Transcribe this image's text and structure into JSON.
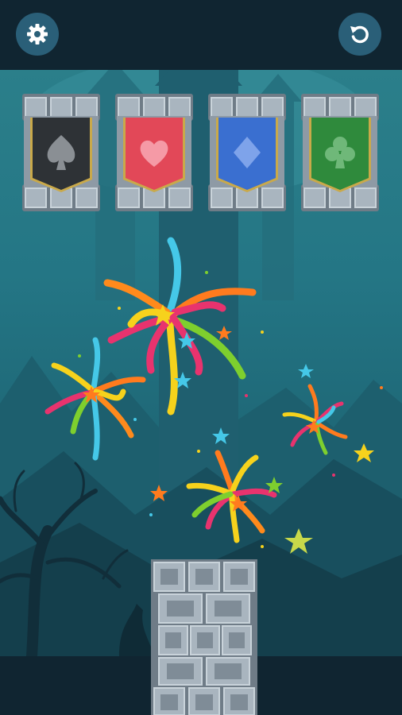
{
  "toolbar": {
    "settings_icon": "gear-icon",
    "restart_icon": "restart-icon"
  },
  "foundations": [
    {
      "suit": "spades",
      "icon": "spade-icon",
      "color": "#2e3236"
    },
    {
      "suit": "hearts",
      "icon": "heart-icon",
      "color": "#e24858"
    },
    {
      "suit": "diamonds",
      "icon": "diamond-icon",
      "color": "#3a6fd0"
    },
    {
      "suit": "clubs",
      "icon": "club-icon",
      "color": "#2f8a3c"
    }
  ],
  "colors": {
    "bar": "#102531",
    "button": "#2a5f78",
    "stone": "#a9b5bf",
    "stone_dark": "#6f7c87"
  }
}
